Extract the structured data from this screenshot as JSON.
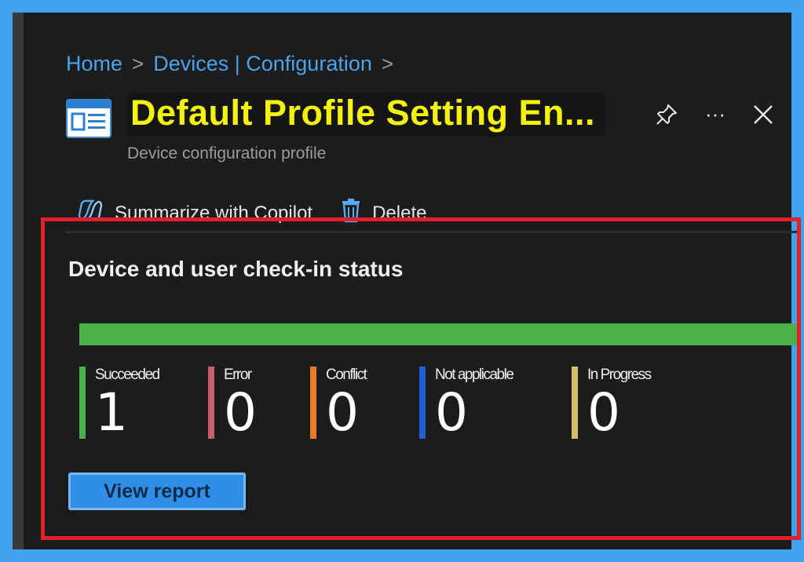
{
  "breadcrumb": {
    "home": "Home",
    "devices": "Devices | Configuration",
    "separator": ">"
  },
  "header": {
    "title": "Default Profile Setting En...",
    "subtitle": "Device configuration profile",
    "icon": "profile-window-icon",
    "actions": [
      "pin-icon",
      "more-icon",
      "close-icon"
    ],
    "more_label": "···",
    "close_label": "✕"
  },
  "toolbar": {
    "copilot_label": "Summarize with Copilot",
    "delete_label": "Delete"
  },
  "checkin": {
    "title": "Device and user check-in status",
    "progress_fraction_succeeded": 1.0,
    "stats": [
      {
        "label": "Succeeded",
        "value": "1",
        "color": "#4ab04a"
      },
      {
        "label": "Error",
        "value": "0",
        "color": "#c8616e"
      },
      {
        "label": "Conflict",
        "value": "0",
        "color": "#ef7a26"
      },
      {
        "label": "Not applicable",
        "value": "0",
        "color": "#1f5fd6"
      },
      {
        "label": "In Progress",
        "value": "0",
        "color": "#d6bf6a"
      }
    ],
    "view_report_label": "View report"
  },
  "colors": {
    "accent_link": "#4aa3ec",
    "title_highlight": "#f4f10a",
    "highlight_border": "#e3202a",
    "outer_frame": "#3fa3f0"
  }
}
